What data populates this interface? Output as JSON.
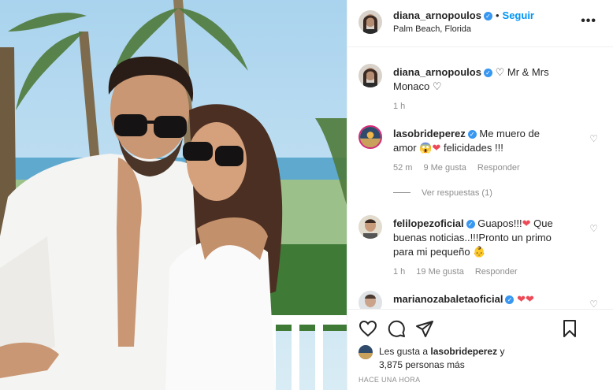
{
  "post": {
    "username": "diana_arnopoulos",
    "follow_label": "Seguir",
    "location": "Palm Beach, Florida",
    "more_label": "•••"
  },
  "caption": {
    "username": "diana_arnopoulos",
    "text": "Mr & Mrs Monaco",
    "time": "1 h"
  },
  "comments": [
    {
      "username": "lasobrideperez",
      "text": "Me muero de amor",
      "text_after": "felicidades !!!",
      "time": "52 m",
      "likes": "9 Me gusta",
      "reply": "Responder"
    },
    {
      "username": "felilopezoficial",
      "text": "Guapos!!!",
      "text_after": "Que buenas noticias..!!!Pronto un primo para mi pequeño",
      "time": "1 h",
      "likes": "19 Me gusta",
      "reply": "Responder"
    },
    {
      "username": "marianozabaletaoficial",
      "text": ""
    }
  ],
  "view_replies": "Ver respuestas (1)",
  "likes": {
    "line1": "Les gusta a",
    "liker": "lasobrideperez",
    "line1_tail": "y",
    "line2": "3,875 personas más"
  },
  "time_ago": "HACE UNA HORA",
  "colors": {
    "accent": "#0095f6",
    "verified": "#3897f0",
    "heart": "#ed4956",
    "secondary_text": "#8e8e8e"
  },
  "icons": [
    "heart-outline-icon",
    "comment-icon",
    "share-icon",
    "bookmark-icon",
    "more-icon",
    "verified-icon"
  ]
}
